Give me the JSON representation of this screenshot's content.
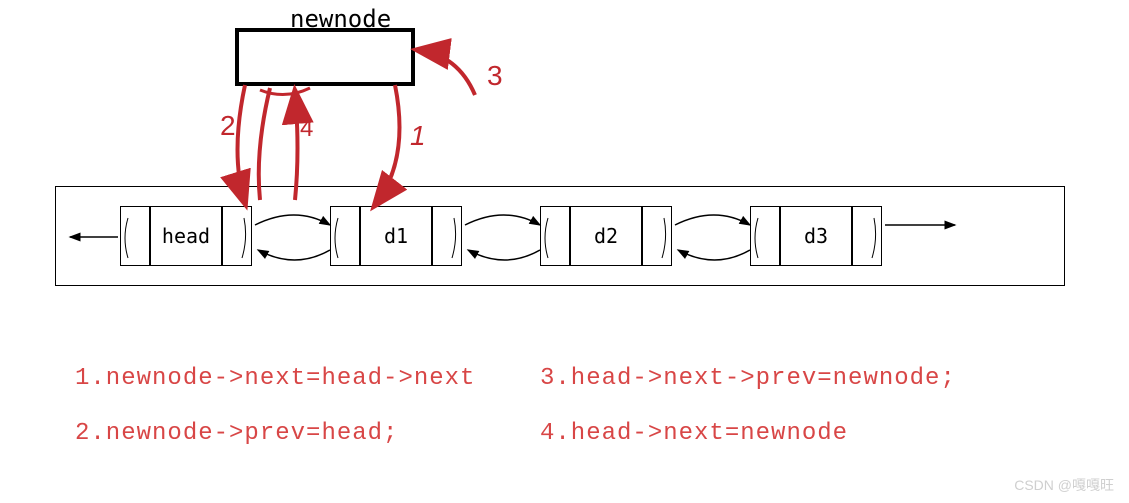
{
  "newnode_label": "newnode",
  "nodes": {
    "head": "head",
    "d1": "d1",
    "d2": "d2",
    "d3": "d3"
  },
  "steps": {
    "s1": "1.newnode->next=head->next",
    "s2": "2.newnode->prev=head;",
    "s3": "3.head->next->prev=newnode;",
    "s4": "4.head->next=newnode"
  },
  "annotations": {
    "a1": "1",
    "a2": "2",
    "a3": "3",
    "a4": "4"
  },
  "watermark": "CSDN @嘎嘎旺"
}
